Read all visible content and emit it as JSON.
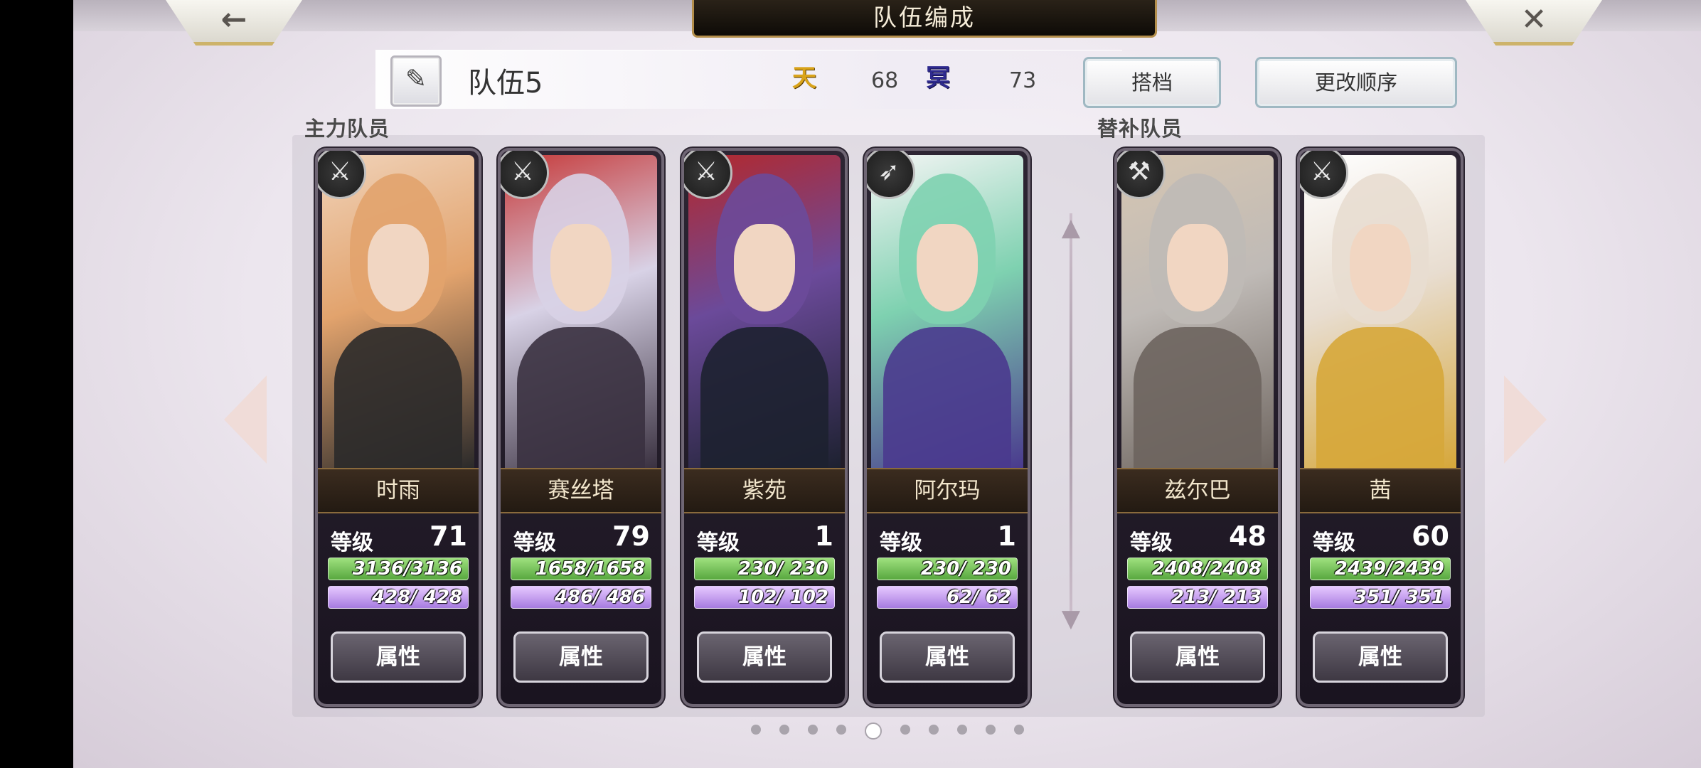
{
  "header": {
    "title": "队伍编成",
    "back_icon": "←",
    "close_icon": "✕"
  },
  "team": {
    "edit_icon": "✎",
    "name": "队伍5",
    "stat1_icon": "天",
    "stat1_value": "68",
    "stat2_icon": "冥",
    "stat2_value": "73"
  },
  "buttons": {
    "partner": "搭档",
    "reorder": "更改顺序"
  },
  "sections": {
    "main": "主力队员",
    "sub": "替补队员"
  },
  "common": {
    "level_label": "等级",
    "attr_label": "属性"
  },
  "members": [
    {
      "name": "时雨",
      "level": "71",
      "hp": "3136/3136",
      "mp": "428/ 428",
      "weapon": "sword",
      "weapon_glyph": "⚔",
      "colors": [
        "#e2a36d",
        "#2b2a2a",
        "#f0d2b8"
      ]
    },
    {
      "name": "赛丝塔",
      "level": "79",
      "hp": "1658/1658",
      "mp": "486/ 486",
      "weapon": "sword",
      "weapon_glyph": "⚔",
      "colors": [
        "#d8d2e6",
        "#3a3140",
        "#c63a3a"
      ]
    },
    {
      "name": "紫苑",
      "level": "1",
      "hp": "230/ 230",
      "mp": "102/ 102",
      "weapon": "katana",
      "weapon_glyph": "⚔",
      "colors": [
        "#6b4a9a",
        "#1d2130",
        "#b3282c"
      ]
    },
    {
      "name": "阿尔玛",
      "level": "1",
      "hp": "230/ 230",
      "mp": "62/ 62",
      "weapon": "bow",
      "weapon_glyph": "➶",
      "colors": [
        "#7ed1b0",
        "#4a3a8e",
        "#f5f5f5"
      ]
    },
    {
      "name": "兹尔巴",
      "level": "48",
      "hp": "2408/2408",
      "mp": "213/ 213",
      "weapon": "axe",
      "weapon_glyph": "⚒",
      "colors": [
        "#bfbab6",
        "#6d645e",
        "#d6c6b2"
      ]
    },
    {
      "name": "茜",
      "level": "60",
      "hp": "2439/2439",
      "mp": "351/ 351",
      "weapon": "sword",
      "weapon_glyph": "⚔",
      "colors": [
        "#e8ddd0",
        "#d6a73a",
        "#ffffff"
      ]
    }
  ],
  "pagination": {
    "total": 10,
    "active": 5
  },
  "divider": {
    "top_glyph": "▲",
    "bottom_glyph": "▼"
  }
}
